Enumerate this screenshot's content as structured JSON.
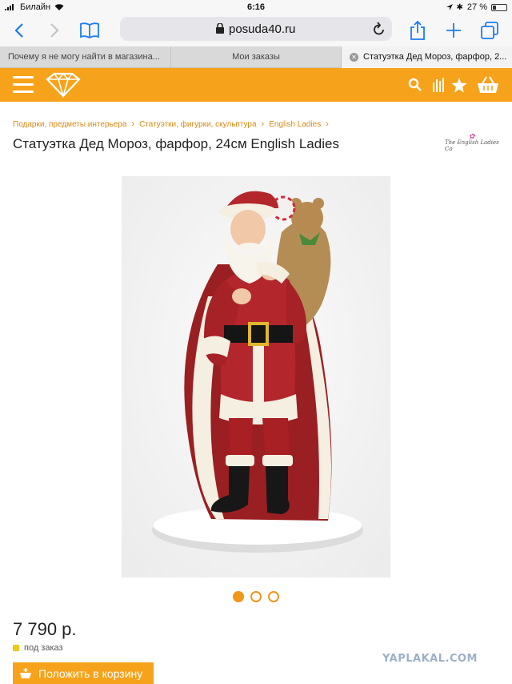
{
  "status_bar": {
    "carrier": "Билайн",
    "time": "6:16",
    "battery": "27 %",
    "battery_level": 0.27
  },
  "browser": {
    "url": "posuda40.ru",
    "tabs": [
      {
        "label": "Почему я не могу найти в магазина..."
      },
      {
        "label": "Мои заказы"
      },
      {
        "label": "Статуэтка Дед Мороз, фарфор, 2..."
      }
    ]
  },
  "breadcrumb": [
    {
      "label": "Подарки, предметы интерьера"
    },
    {
      "label": "Статуэтки, фигурки, скульптура"
    },
    {
      "label": "English Ladies"
    }
  ],
  "product": {
    "title": "Статуэтка Дед Мороз, фарфор, 24см English Ladies",
    "brand_logo": "The English Ladies Co",
    "price": "7 790 р.",
    "availability": "под заказ",
    "add_to_cart": "Положить в корзину",
    "image_count": 3,
    "active_image": 1
  },
  "colors": {
    "accent": "#f7a21b",
    "link": "#d98a15",
    "availability": "#f2c81a"
  },
  "watermark": "YAPLAKAL.COM"
}
